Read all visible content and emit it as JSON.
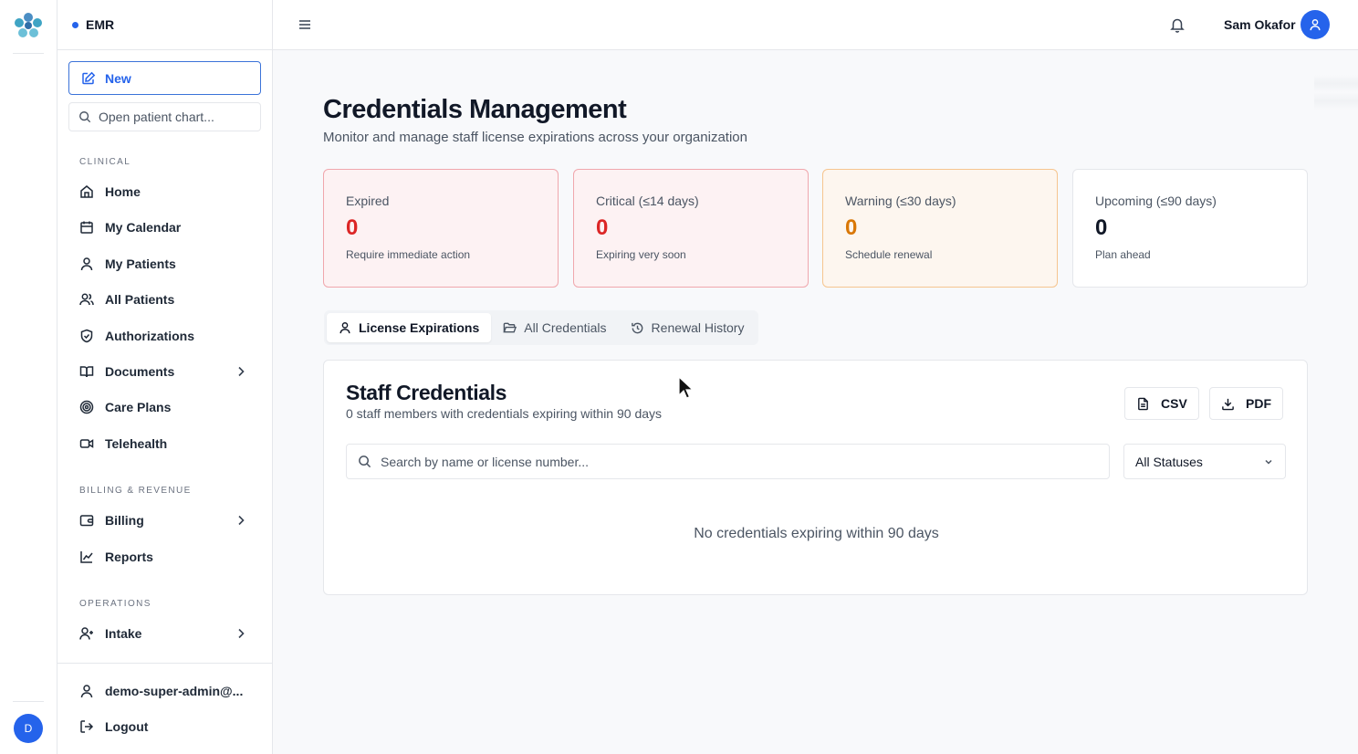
{
  "sidebar": {
    "app_name": "EMR",
    "new_label": "New",
    "chart_placeholder": "Open patient chart...",
    "sections": {
      "clinical": "CLINICAL",
      "billing": "BILLING & REVENUE",
      "operations": "OPERATIONS"
    },
    "items": {
      "home": "Home",
      "calendar": "My Calendar",
      "my_patients": "My Patients",
      "all_patients": "All Patients",
      "authorizations": "Authorizations",
      "documents": "Documents",
      "care_plans": "Care Plans",
      "telehealth": "Telehealth",
      "billing": "Billing",
      "reports": "Reports",
      "intake": "Intake"
    },
    "account": "demo-super-admin@...",
    "logout": "Logout",
    "rail_avatar": "D"
  },
  "topbar": {
    "user_name": "Sam Okafor"
  },
  "main": {
    "title": "Credentials Management",
    "subtitle": "Monitor and manage staff license expirations across your organization",
    "stats": [
      {
        "label": "Expired",
        "value": "0",
        "desc": "Require immediate action",
        "tone": "red"
      },
      {
        "label": "Critical (≤14 days)",
        "value": "0",
        "desc": "Expiring very soon",
        "tone": "red"
      },
      {
        "label": "Warning (≤30 days)",
        "value": "0",
        "desc": "Schedule renewal",
        "tone": "orange"
      },
      {
        "label": "Upcoming (≤90 days)",
        "value": "0",
        "desc": "Plan ahead",
        "tone": "neutral"
      }
    ],
    "tabs": {
      "license": "License Expirations",
      "all": "All Credentials",
      "history": "Renewal History"
    },
    "card": {
      "title": "Staff Credentials",
      "subtitle": "0 staff members with credentials expiring within 90 days",
      "csv": "CSV",
      "pdf": "PDF",
      "search_placeholder": "Search by name or license number...",
      "status_filter": "All Statuses",
      "empty": "No credentials expiring within 90 days"
    }
  },
  "colors": {
    "accent": "#2563eb",
    "expired": "#dc2626",
    "warning": "#d97706"
  }
}
